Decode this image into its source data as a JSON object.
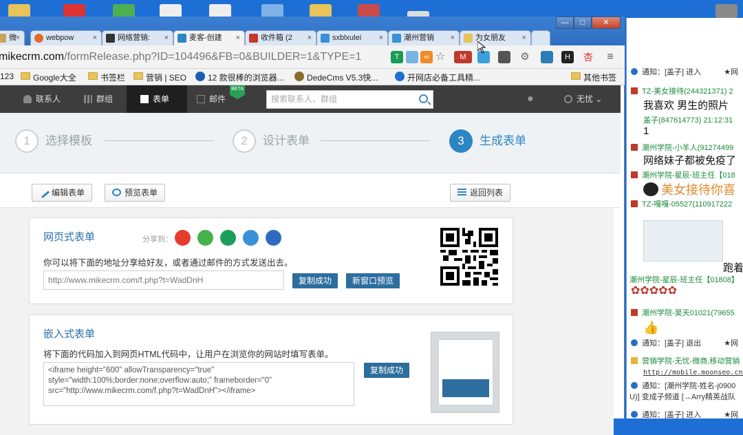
{
  "tabs": [
    {
      "label": "微",
      "close": "×"
    },
    {
      "label": "webpow",
      "close": "×"
    },
    {
      "label": "网络营销:",
      "close": "×"
    },
    {
      "label": "麦客-创建",
      "close": "×"
    },
    {
      "label": "收件箱 (2",
      "close": "×"
    },
    {
      "label": "sxblxulei",
      "close": "×"
    },
    {
      "label": "潮州营销",
      "close": "×"
    },
    {
      "label": "为女朋友",
      "close": "×"
    }
  ],
  "address": {
    "prefix": "mikecrm.com",
    "rest": "/formRelease.php?ID=104496&FB=0&BUILDER=1&TYPE=1"
  },
  "window_buttons": {
    "minimize": "—",
    "maximize": "□",
    "close": "✕"
  },
  "bookmarks": [
    "123",
    "Google大全",
    "书签栏",
    "营销 | SEO",
    "12 款很棒的浏览器...",
    "DedeCms V5.3快...",
    "开网店必备工具精...",
    "其他书签"
  ],
  "appnav": {
    "items": [
      "联系人",
      "群组",
      "表单",
      "邮件"
    ],
    "beta": "BETA",
    "search_placeholder": "搜索联系人、群组",
    "user": "无忧"
  },
  "steps": [
    {
      "num": "1",
      "label": "选择模板"
    },
    {
      "num": "2",
      "label": "设计表单"
    },
    {
      "num": "3",
      "label": "生成表单"
    }
  ],
  "toolbar": {
    "edit": "编辑表单",
    "preview": "预览表单",
    "back": "返回列表"
  },
  "webform": {
    "title": "网页式表单",
    "share_label": "分享到：",
    "desc": "你可以将下面的地址分享给好友，或者通过邮件的方式发送出去。",
    "url": "http://www.mikecrm.com/f.php?t=WadDnH",
    "copy_btn": "复制成功",
    "newwin_btn": "新窗口预览"
  },
  "embed": {
    "title": "嵌入式表单",
    "desc": "将下面的代码加入到网页HTML代码中，让用户在浏览你的网站时填写表单。",
    "code_line1": "<iframe height=\"600\" allowTransparency=\"true\"",
    "code_line2": "style=\"width:100%;border:none;overflow:auto;\" frameborder=\"0\"",
    "code_line3": "src=\"http://www.mikecrm.com/f.php?t=WadDnH\"></iframe>",
    "copy_btn": "复制成功"
  },
  "chat": {
    "r1": "通知：[盖子] 进入",
    "r1b": "★网",
    "r2": "TZ-美女接待(244321371) 2",
    "r3": "我喜欢  男生的照片",
    "r4": "盖子(847614773) 21:12:31",
    "r5": "1",
    "r6": "潮州学院-小羊人(91274499",
    "r7": "网络妹子都被免疫了",
    "r8": "潮州学院-星辰-班主任【018",
    "r9": "美女接待你喜",
    "r10": "TZ-嘎嘎-05527(110917222",
    "r11": "跑着",
    "r12": "潮州学院-星辰-班主任【01808】",
    "r13": "潮州学院-昊天01021(79655",
    "r14": "通知：[盖子] 退出",
    "r14b": "★网",
    "r15": "营销学院-无忧-微商,移动营销",
    "r16": "http://mobile.moonseo.cn/",
    "r17": "通知：[潮州学院-姓名-j0900",
    "r18": "U)] 变成子频道 [→Arry精英战队",
    "r19": "通知：[盖子] 进入",
    "r19b": "★网"
  },
  "colors": {
    "accent": "#2d86c4",
    "nav_bg": "#3d3d3d",
    "button_blue": "#2d6e9e"
  }
}
